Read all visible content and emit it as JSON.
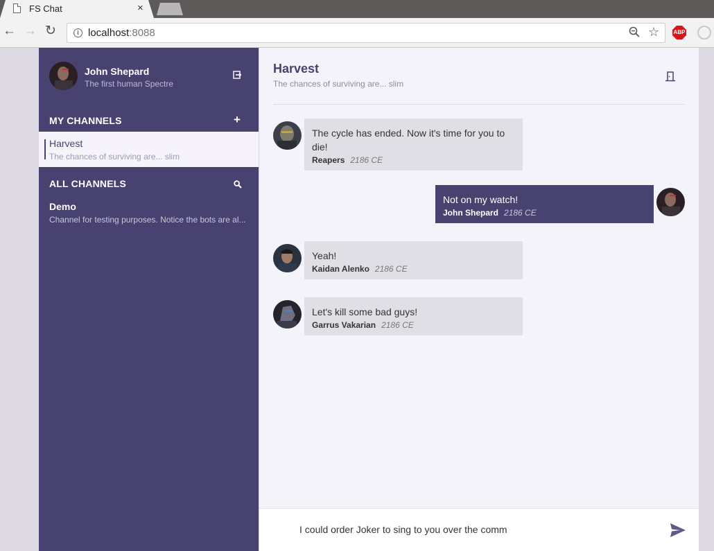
{
  "browser": {
    "tab_title": "FS Chat",
    "tab_close": "×",
    "url_host": "localhost",
    "url_port": ":8088",
    "info_glyph": "i",
    "back_glyph": "←",
    "forward_glyph": "→",
    "reload_glyph": "↻",
    "zoom_glyph": "🔍",
    "star_glyph": "☆",
    "abp_label": "ABP"
  },
  "user": {
    "name": "John Shepard",
    "tagline": "The first human Spectre"
  },
  "sidebar": {
    "my_channels_label": "MY CHANNELS",
    "add_glyph": "+",
    "all_channels_label": "ALL CHANNELS",
    "my_channels": [
      {
        "name": "Harvest",
        "description": "The chances of surviving are... slim"
      }
    ],
    "all_channels": [
      {
        "name": "Demo",
        "description": "Channel for testing purposes. Notice the bots are al..."
      }
    ]
  },
  "channel": {
    "title": "Harvest",
    "subtitle": "The chances of surviving are... slim"
  },
  "messages": [
    {
      "text": "The cycle has ended. Now it's time for you to die!",
      "author": "Reapers",
      "time": "2186 CE",
      "mine": false
    },
    {
      "text": "Not on my watch!",
      "author": "John Shepard",
      "time": "2186 CE",
      "mine": true
    },
    {
      "text": "Yeah!",
      "author": "Kaidan Alenko",
      "time": "2186 CE",
      "mine": false
    },
    {
      "text": "Let's kill some bad guys!",
      "author": "Garrus Vakarian",
      "time": "2186 CE",
      "mine": false
    }
  ],
  "composer": {
    "value": "I could order Joker to sing to you over the comm"
  },
  "colors": {
    "brand": "#474270",
    "bubble_other": "#e1dfe6",
    "main_bg": "#f5f3fa"
  }
}
